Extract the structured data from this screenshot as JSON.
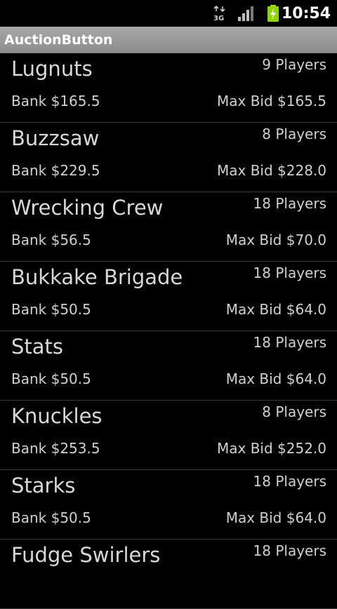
{
  "status_bar": {
    "network_icon": "3g-data-icon",
    "signal_icon": "signal-strength-icon",
    "battery_icon": "battery-charging-icon",
    "time": "10:54"
  },
  "app": {
    "title": "AuctionButton"
  },
  "colors": {
    "title_bar_top": "#a9a9a9",
    "title_bar_bottom": "#8c8c8c",
    "background": "#000000",
    "text": "#d8d8d8",
    "battery_green": "#8fd400"
  },
  "teams": [
    {
      "name": "Lugnuts",
      "players": "9 Players",
      "bank": "Bank $165.5",
      "max_bid": "Max Bid $165.5"
    },
    {
      "name": "Buzzsaw",
      "players": "8 Players",
      "bank": "Bank $229.5",
      "max_bid": "Max Bid $228.0"
    },
    {
      "name": "Wrecking Crew",
      "players": "18 Players",
      "bank": "Bank $56.5",
      "max_bid": "Max Bid $70.0"
    },
    {
      "name": "Bukkake Brigade",
      "players": "18 Players",
      "bank": "Bank $50.5",
      "max_bid": "Max Bid $64.0"
    },
    {
      "name": "Stats",
      "players": "18 Players",
      "bank": "Bank $50.5",
      "max_bid": "Max Bid $64.0"
    },
    {
      "name": "Knuckles",
      "players": "8 Players",
      "bank": "Bank $253.5",
      "max_bid": "Max Bid $252.0"
    },
    {
      "name": "Starks",
      "players": "18 Players",
      "bank": "Bank $50.5",
      "max_bid": "Max Bid $64.0"
    },
    {
      "name": "Fudge Swirlers",
      "players": "18 Players",
      "bank": "",
      "max_bid": ""
    }
  ]
}
